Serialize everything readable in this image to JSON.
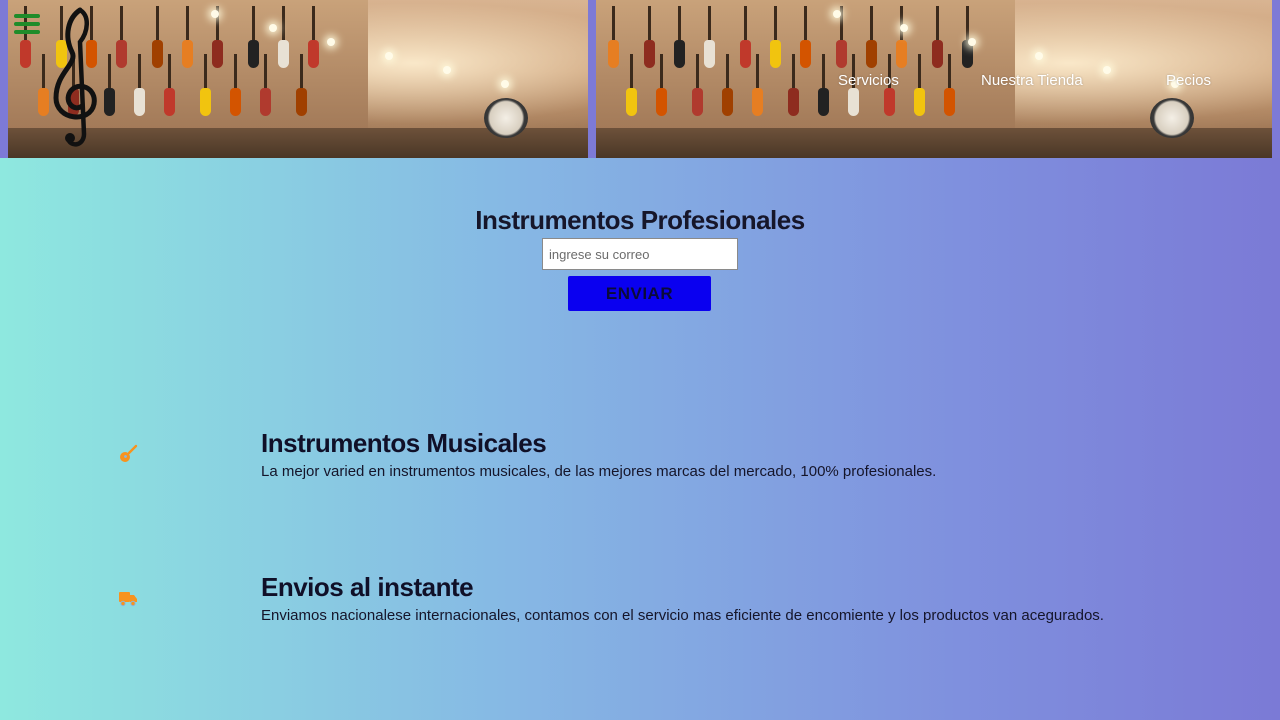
{
  "nav": {
    "items": [
      {
        "label": "Servicios"
      },
      {
        "label": "Nuestra Tienda"
      },
      {
        "label": "Pecios"
      }
    ]
  },
  "hero": {
    "title": "Instrumentos Profesionales",
    "email_placeholder": "ingrese su correo",
    "submit_label": "ENVIAR"
  },
  "features": [
    {
      "icon": "guitar-icon",
      "title": "Instrumentos Musicales",
      "text": "La mejor varied en instrumentos musicales, de las mejores marcas del mercado, 100% profesionales."
    },
    {
      "icon": "truck-icon",
      "title": "Envios al instante",
      "text": "Enviamos nacionalese internacionales, contamos con el servicio mas eficiente de encomiente y los productos van acegurados."
    }
  ],
  "colors": {
    "accent_icon": "#f7931e",
    "menu_icon": "#1f8c2a",
    "button_bg": "#0a00f0",
    "gradient_start": "#8ee8df",
    "gradient_end": "#7b7ad6"
  }
}
